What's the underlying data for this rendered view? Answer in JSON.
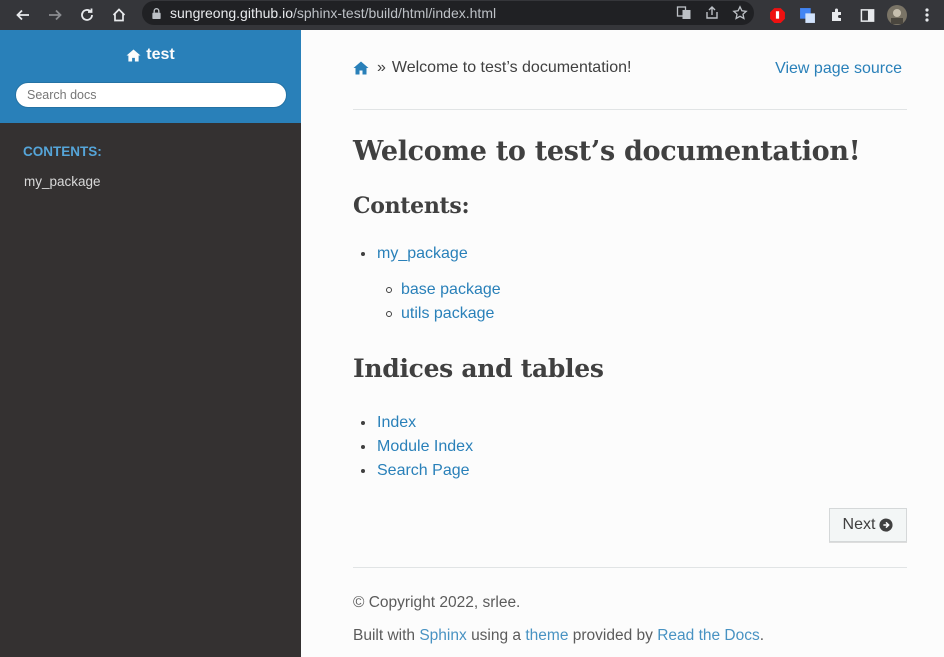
{
  "browser": {
    "url_host": "sungreong.github.io",
    "url_path": "/sphinx-test/build/html/index.html"
  },
  "sidebar": {
    "project": "test",
    "search_placeholder": "Search docs",
    "caption": "CONTENTS:",
    "items": [
      {
        "label": "my_package"
      }
    ]
  },
  "breadcrumb": {
    "current": "Welcome to test’s documentation!",
    "separator": "»"
  },
  "view_source": "View page source",
  "title": "Welcome to test’s documentation!",
  "contents": {
    "heading": "Contents:",
    "items": [
      {
        "label": "my_package",
        "children": [
          {
            "label": "base package"
          },
          {
            "label": "utils package"
          }
        ]
      }
    ]
  },
  "indices": {
    "heading": "Indices and tables",
    "items": [
      {
        "label": "Index"
      },
      {
        "label": "Module Index"
      },
      {
        "label": "Search Page"
      }
    ]
  },
  "next_label": "Next",
  "footer": {
    "copyright": "© Copyright 2022, srlee.",
    "built_with": "Built with",
    "sphinx": "Sphinx",
    "using_a": "using a",
    "theme": "theme",
    "provided_by": "provided by",
    "rtd": "Read the Docs",
    "period": "."
  },
  "colors": {
    "accent": "#2980b9",
    "sidebar_bg": "#343131",
    "caption": "#55a5d9"
  }
}
